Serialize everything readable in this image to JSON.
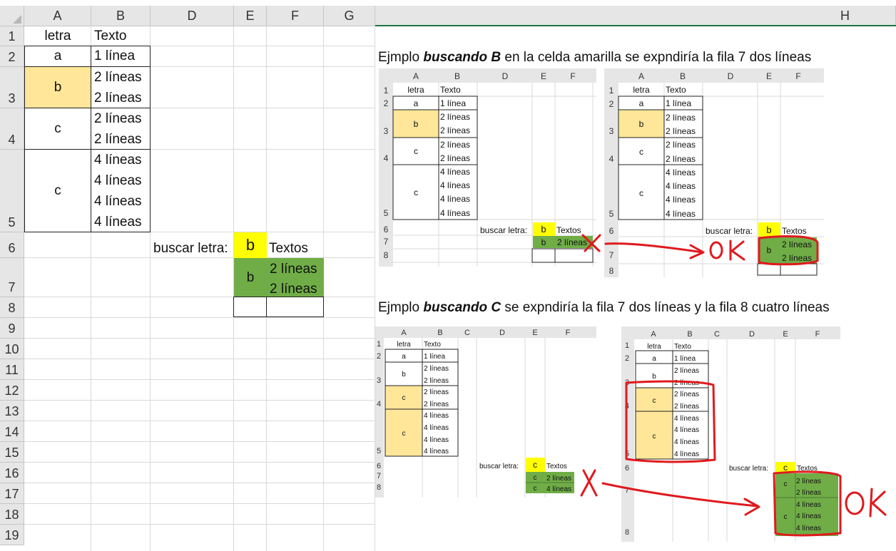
{
  "columns": [
    "A",
    "B",
    "D",
    "E",
    "F",
    "G",
    "H"
  ],
  "rows": [
    "1",
    "2",
    "3",
    "4",
    "5",
    "6",
    "7",
    "8",
    "9",
    "10",
    "11",
    "12",
    "13",
    "14",
    "15",
    "16",
    "17",
    "18",
    "19"
  ],
  "sheet": {
    "a1": "letra",
    "b1": "Texto",
    "a2": "a",
    "b2": "1 línea",
    "a3": "b",
    "b3": [
      "2 líneas",
      "2 líneas"
    ],
    "a4": "c",
    "b4": [
      "2 líneas",
      "2 líneas"
    ],
    "a5": "c",
    "b5": [
      "4 líneas",
      "4 líneas",
      "4 líneas",
      "4 líneas"
    ],
    "d6": "buscar letra:",
    "e6": "b",
    "f6": "Textos",
    "e7": "b",
    "f7": [
      "2 líneas",
      "2 líneas"
    ]
  },
  "example1": {
    "prefix": "Ejmplo ",
    "bold": "buscando B ",
    "suffix": " en la celda amarilla se expndiría la fila 7 dos líneas"
  },
  "example2": {
    "prefix": "Ejmplo ",
    "bold": "buscando C ",
    "suffix": " se expndiría la fila 7 dos líneas y la fila 8 cuatro líneas"
  },
  "ok_label": "OK",
  "colors": {
    "yellow_cell": "#ffe699",
    "lookup_yellow": "#ffff00",
    "green": "#70ad47",
    "header_bg": "#e6e6e6",
    "grid": "#d9d9d9",
    "annotation": "#e0191e"
  }
}
